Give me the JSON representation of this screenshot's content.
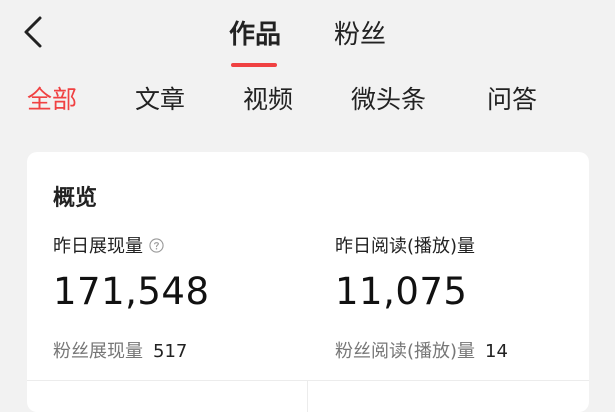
{
  "header": {
    "back_icon": "chevron-left-icon",
    "tabs": [
      {
        "label": "作品",
        "active": true
      },
      {
        "label": "粉丝",
        "active": false
      }
    ],
    "accent_color": "#f04142"
  },
  "sub_tabs": [
    {
      "label": "全部",
      "active": true
    },
    {
      "label": "文章",
      "active": false
    },
    {
      "label": "视频",
      "active": false
    },
    {
      "label": "微头条",
      "active": false
    },
    {
      "label": "问答",
      "active": false
    }
  ],
  "overview": {
    "title": "概览",
    "impressions": {
      "label": "昨日展现量",
      "help_icon": "question-circle-icon",
      "value": "171,548",
      "fan_label": "粉丝展现量",
      "fan_value": "517"
    },
    "reads": {
      "label": "昨日阅读(播放)量",
      "value": "11,075",
      "fan_label": "粉丝阅读(播放)量",
      "fan_value": "14"
    }
  }
}
